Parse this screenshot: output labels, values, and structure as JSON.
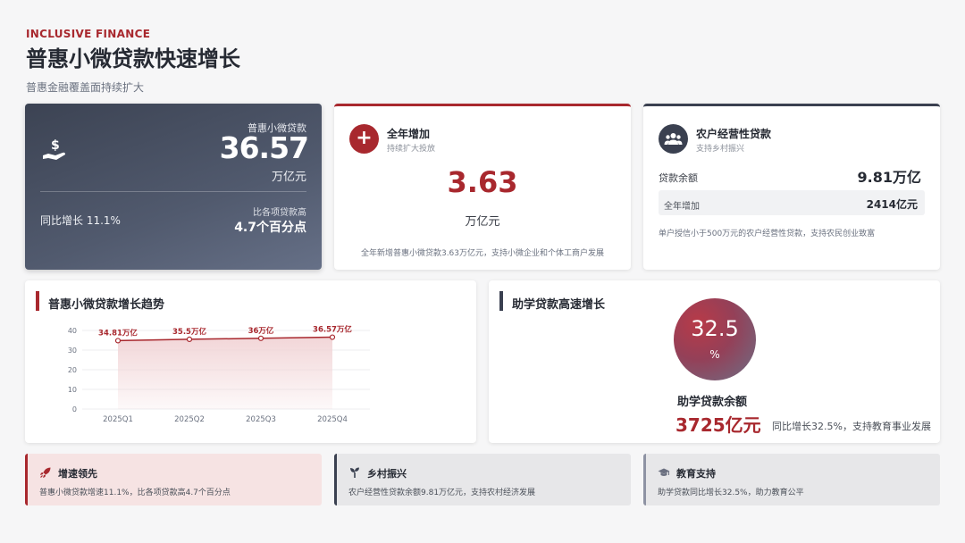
{
  "header": {
    "eyebrow": "INCLUSIVE FINANCE",
    "title": "普惠小微贷款快速增长",
    "subtitle": "普惠金融覆盖面持续扩大"
  },
  "hero": {
    "label": "普惠小微贷款",
    "value": "36.57",
    "unit": "万亿元",
    "growth": "同比增长 11.1%",
    "compare_label": "比各项贷款高",
    "compare_value": "4.7个百分点",
    "icon": "hand-money-icon"
  },
  "annual_add": {
    "title": "全年增加",
    "subtitle": "持续扩大投放",
    "value": "3.63",
    "unit": "万亿元",
    "note": "全年新增普惠小微贷款3.63万亿元，支持小微企业和个体工商户发展",
    "icon": "plus-icon"
  },
  "farmer": {
    "title": "农户经营性贷款",
    "subtitle": "支持乡村振兴",
    "balance_label": "贷款余额",
    "balance_value": "9.81万亿",
    "add_label": "全年增加",
    "add_value": "2414亿元",
    "note": "单户授信小于500万元的农户经营性贷款，支持农民创业致富",
    "icon": "users-icon"
  },
  "trend": {
    "title": "普惠小微贷款增长趋势"
  },
  "chart_data": {
    "type": "area",
    "categories": [
      "2025Q1",
      "2025Q2",
      "2025Q3",
      "2025Q4"
    ],
    "values": [
      34.81,
      35.5,
      36,
      36.57
    ],
    "data_labels": [
      "34.81万亿",
      "35.5万亿",
      "36万亿",
      "36.57万亿"
    ],
    "ylim": [
      0,
      40
    ],
    "yticks": [
      0,
      10,
      20,
      30,
      40
    ],
    "grid": true,
    "colors": {
      "line": "#a8282e",
      "fill": "#f2d6d8"
    }
  },
  "student": {
    "title": "助学贷款高速增长",
    "percent": "32.5",
    "percent_unit": "%",
    "label": "助学贷款余额",
    "value": "3725亿元",
    "note": "同比增长32.5%，支持教育事业发展"
  },
  "strips": [
    {
      "title": "增速领先",
      "desc": "普惠小微贷款增速11.1%，比各项贷款高4.7个百分点",
      "icon": "rocket-icon"
    },
    {
      "title": "乡村振兴",
      "desc": "农户经营性贷款余额9.81万亿元，支持农村经济发展",
      "icon": "sprout-icon"
    },
    {
      "title": "教育支持",
      "desc": "助学贷款同比增长32.5%，助力教育公平",
      "icon": "graduation-cap-icon"
    }
  ],
  "colors": {
    "accent": "#a8282e",
    "dark": "#3a4050"
  }
}
